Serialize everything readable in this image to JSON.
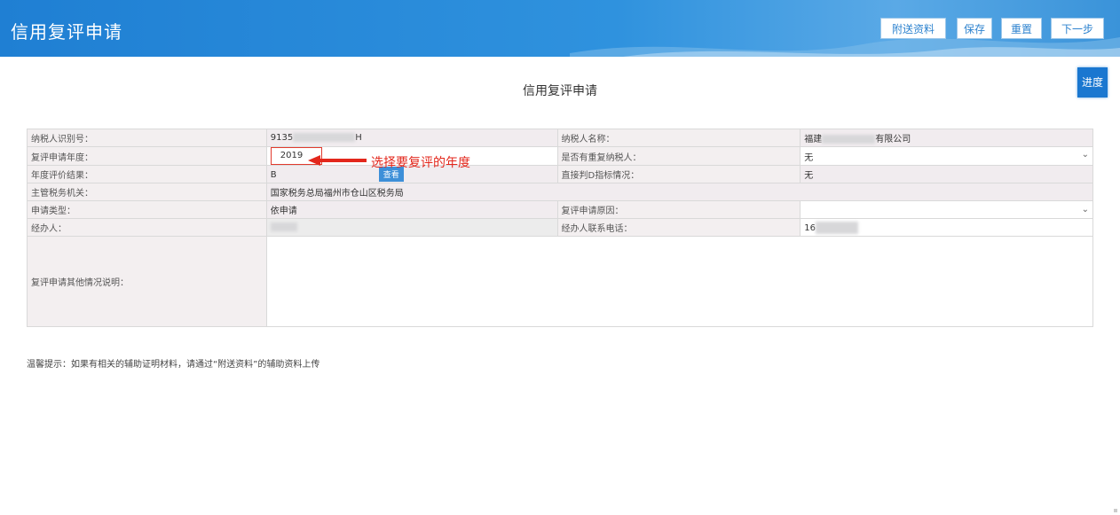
{
  "header": {
    "title": "信用复评申请",
    "buttons": {
      "attach": "附送资料",
      "save": "保存",
      "reset": "重置",
      "next": "下一步"
    }
  },
  "progress_label": "进度",
  "page_heading": "信用复评申请",
  "form": {
    "taxpayer_id_label": "纳税人识别号：",
    "taxpayer_id_value": "9135",
    "taxpayer_id_suffix": "H",
    "taxpayer_name_label": "纳税人名称：",
    "taxpayer_name_prefix": "福建",
    "taxpayer_name_suffix": "有限公司",
    "year_label": "复评申请年度：",
    "year_value": "2019",
    "duplicate_label": "是否有重复纳税人：",
    "duplicate_value": "无",
    "annual_result_label": "年度评价结果：",
    "annual_result_value": "B",
    "view_button": "查看",
    "direct_d_label": "直接判D指标情况：",
    "direct_d_value": "无",
    "tax_authority_label": "主管税务机关：",
    "tax_authority_value": "国家税务总局福州市仓山区税务局",
    "apply_type_label": "申请类型：",
    "apply_type_value": "依申请",
    "reason_label": "复评申请原因：",
    "reason_value": "",
    "handler_label": "经办人：",
    "handler_phone_label": "经办人联系电话：",
    "handler_phone_value": "16",
    "other_desc_label": "复评申请其他情况说明："
  },
  "annotation": "选择要复评的年度",
  "tip": "温馨提示：如果有相关的辅助证明材料，请通过“附送资料”的辅助资料上传",
  "colors": {
    "header_blue": "#1f7fd3",
    "annotation_red": "#e3271c",
    "button_blue": "#1a77d0"
  }
}
